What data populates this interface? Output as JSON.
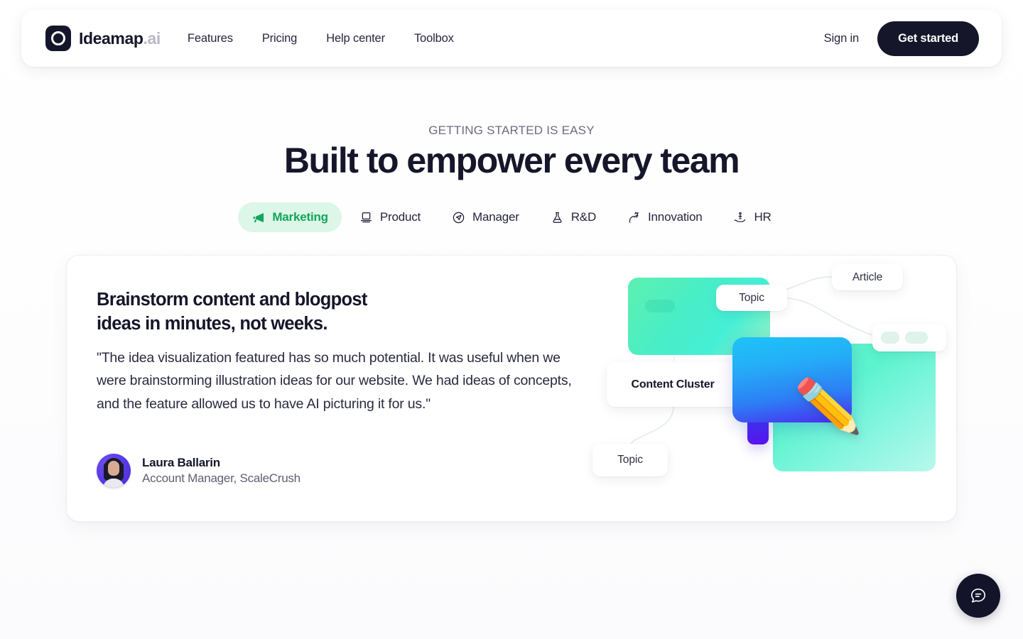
{
  "header": {
    "brand": {
      "name": "Ideamap",
      "tld": ".ai",
      "logo_icon": "circle-dot-logo-icon"
    },
    "nav": [
      {
        "label": "Features"
      },
      {
        "label": "Pricing"
      },
      {
        "label": "Help center"
      },
      {
        "label": "Toolbox"
      }
    ],
    "sign_in_label": "Sign in",
    "cta_label": "Get started"
  },
  "hero": {
    "eyebrow": "GETTING STARTED IS EASY",
    "headline": "Built to empower every team"
  },
  "tabs": [
    {
      "label": "Marketing",
      "icon": "megaphone-icon",
      "active": true
    },
    {
      "label": "Product",
      "icon": "laptop-icon",
      "active": false
    },
    {
      "label": "Manager",
      "icon": "compass-arrow-icon",
      "active": false
    },
    {
      "label": "R&D",
      "icon": "flask-icon",
      "active": false
    },
    {
      "label": "Innovation",
      "icon": "unicorn-icon",
      "active": false
    },
    {
      "label": "HR",
      "icon": "hand-person-icon",
      "active": false
    }
  ],
  "card": {
    "title": "Brainstorm content and blogpost\nideas in minutes, not weeks.",
    "quote": "\"The idea visualization featured has so much potential. It was useful when we were brainstorming illustration ideas for our website. We had ideas of concepts, and the feature allowed us to have AI picturing it for us.\"",
    "author": {
      "name": "Laura Ballarin",
      "role": "Account Manager, ScaleCrush",
      "avatar_icon": "user-avatar"
    }
  },
  "illustration": {
    "nodes": [
      {
        "label": "Topic"
      },
      {
        "label": "Article"
      },
      {
        "label": "Content Cluster"
      },
      {
        "label": "Topic"
      }
    ],
    "pencil_emoji": "✏️"
  },
  "chat": {
    "icon": "chat-bubble-icon"
  },
  "colors": {
    "accent_green": "#12a55c",
    "accent_green_bg": "#dcf6e7",
    "dark": "#16162b",
    "page_bg": "#ffffff"
  }
}
